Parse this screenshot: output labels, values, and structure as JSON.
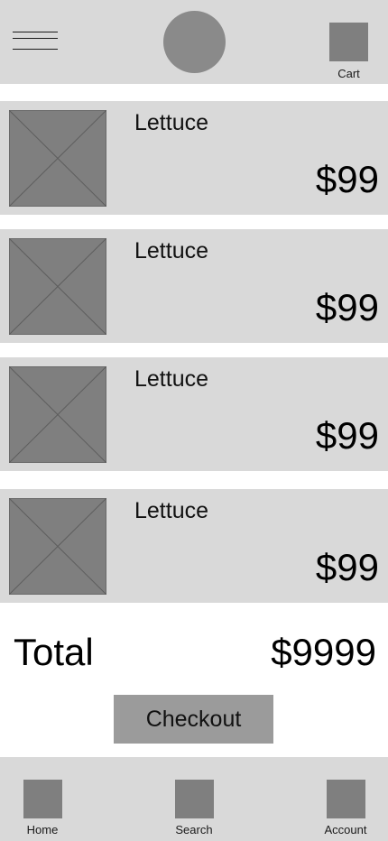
{
  "header": {
    "menu_icon": "hamburger-icon",
    "logo": "logo-placeholder",
    "cart": {
      "icon": "cart-icon",
      "label": "Cart"
    }
  },
  "cart_items": [
    {
      "name": "Lettuce",
      "price": "$99",
      "image": "image-placeholder-icon"
    },
    {
      "name": "Lettuce",
      "price": "$99",
      "image": "image-placeholder-icon"
    },
    {
      "name": "Lettuce",
      "price": "$99",
      "image": "image-placeholder-icon"
    },
    {
      "name": "Lettuce",
      "price": "$99",
      "image": "image-placeholder-icon"
    }
  ],
  "summary": {
    "total_label": "Total",
    "total_value": "$9999",
    "checkout_label": "Checkout"
  },
  "bottom_nav": [
    {
      "label": "Home",
      "icon": "home-icon"
    },
    {
      "label": "Search",
      "icon": "search-icon"
    },
    {
      "label": "Account",
      "icon": "account-icon"
    }
  ],
  "colors": {
    "panel": "#d9d9d9",
    "placeholder": "#7f7f7f",
    "button": "#9b9b9b",
    "background": "#ffffff"
  }
}
